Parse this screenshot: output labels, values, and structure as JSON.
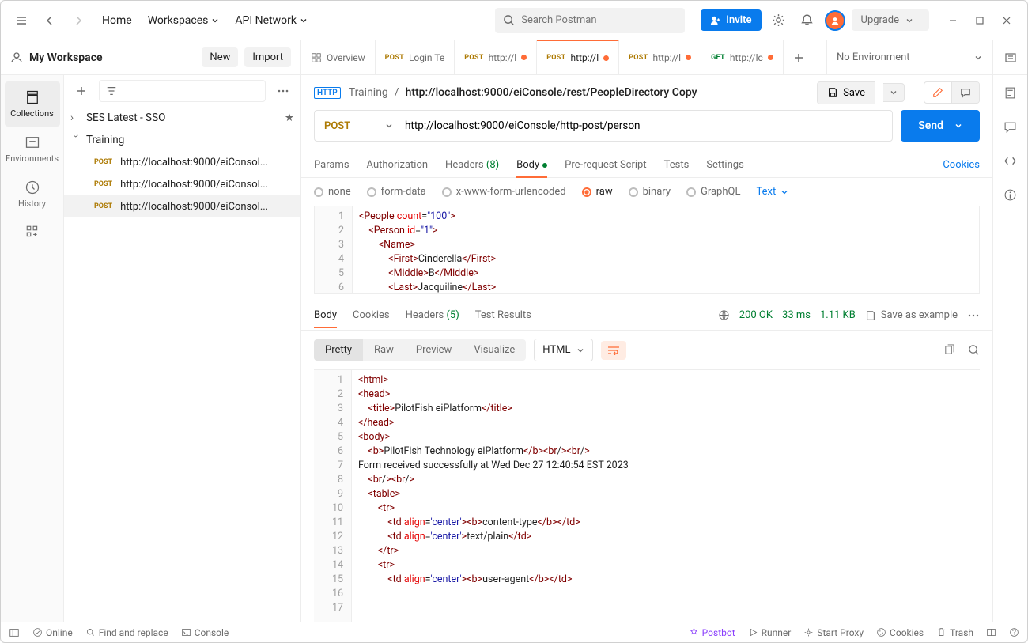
{
  "topbar": {
    "home": "Home",
    "workspaces": "Workspaces",
    "api_network": "API Network",
    "search_placeholder": "Search Postman",
    "invite": "Invite",
    "upgrade": "Upgrade"
  },
  "workspace": {
    "title": "My Workspace",
    "new_btn": "New",
    "import_btn": "Import"
  },
  "rail": {
    "collections": "Collections",
    "environments": "Environments",
    "history": "History"
  },
  "tabs": {
    "overview": "Overview",
    "items": [
      {
        "method": "POST",
        "label": "Login Te",
        "dirty": false
      },
      {
        "method": "POST",
        "label": "http://l",
        "dirty": true
      },
      {
        "method": "POST",
        "label": "http://l",
        "dirty": true,
        "active": true
      },
      {
        "method": "POST",
        "label": "http://l",
        "dirty": true
      },
      {
        "method": "GET",
        "label": "http://lc",
        "dirty": true
      }
    ],
    "env": "No Environment"
  },
  "tree": {
    "root1": "SES Latest - SSO",
    "root2": "Training",
    "children": [
      "http://localhost:9000/eiConsol...",
      "http://localhost:9000/eiConsol...",
      "http://localhost:9000/eiConsol..."
    ]
  },
  "breadcrumb": {
    "parent": "Training",
    "current": "http://localhost:9000/eiConsole/rest/PeopleDirectory Copy",
    "save": "Save"
  },
  "request": {
    "method": "POST",
    "url": "http://localhost:9000/eiConsole/http-post/person",
    "send": "Send",
    "tabs": {
      "params": "Params",
      "auth": "Authorization",
      "headers": "Headers",
      "headers_count": "(8)",
      "body": "Body",
      "prere": "Pre-request Script",
      "tests": "Tests",
      "settings": "Settings",
      "cookies": "Cookies"
    },
    "body_types": {
      "none": "none",
      "form": "form-data",
      "url": "x-www-form-urlencoded",
      "raw": "raw",
      "binary": "binary",
      "graphql": "GraphQL",
      "text": "Text"
    },
    "body_lines": [
      "<People count=\"100\">",
      "    <Person id=\"1\">",
      "        <Name>",
      "            <First>Cinderella</First>",
      "            <Middle>B</Middle>",
      "            <Last>Jacquiline</Last>"
    ]
  },
  "response": {
    "tabs": {
      "body": "Body",
      "cookies": "Cookies",
      "headers": "Headers",
      "headers_count": "(5)",
      "tests": "Test Results"
    },
    "status": "200 OK",
    "time": "33 ms",
    "size": "1.11 KB",
    "save_example": "Save as example",
    "views": {
      "pretty": "Pretty",
      "raw": "Raw",
      "preview": "Preview",
      "visualize": "Visualize",
      "lang": "HTML"
    },
    "lines": [
      "<html>",
      "",
      "<head>",
      "    <title>PilotFish eiPlatform</title>",
      "</head>",
      "",
      "<body>",
      "    <b>PilotFish Technology eiPlatform</b><br/><br/>",
      "Form received successfully at Wed Dec 27 12:40:54 EST 2023",
      "    <br/><br/>",
      "    <table>",
      "        <tr>",
      "            <td align='center'><b>content-type</b></td>",
      "            <td align='center'>text/plain</td>",
      "        </tr>",
      "        <tr>",
      "            <td align='center'><b>user-agent</b></td>"
    ]
  },
  "statusbar": {
    "online": "Online",
    "find": "Find and replace",
    "console": "Console",
    "postbot": "Postbot",
    "runner": "Runner",
    "proxy": "Start Proxy",
    "cookies": "Cookies",
    "trash": "Trash"
  }
}
